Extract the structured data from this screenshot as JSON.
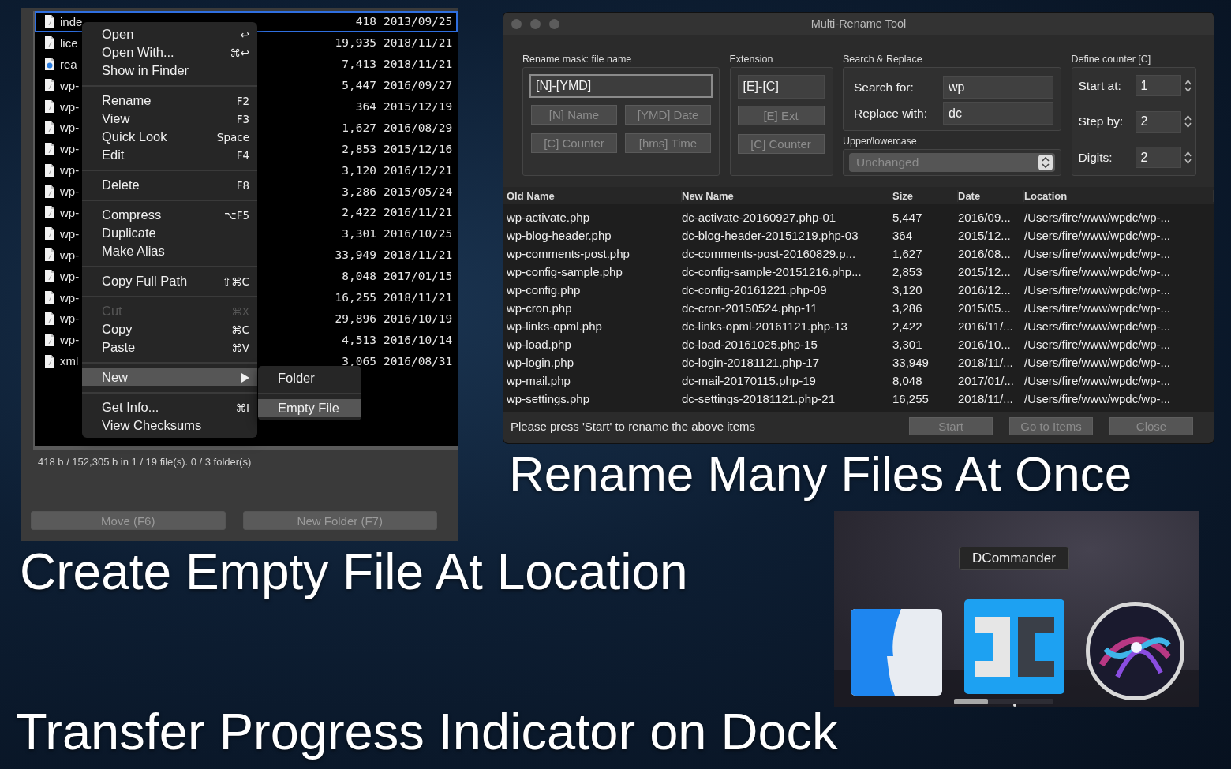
{
  "file_panel": {
    "rows": [
      {
        "name": "inde",
        "size": "418",
        "date": "2013/09/25",
        "kind": "doc",
        "selected": true
      },
      {
        "name": "lice",
        "size": "19,935",
        "date": "2018/11/21",
        "kind": "doc",
        "selected": false
      },
      {
        "name": "rea",
        "size": "7,413",
        "date": "2018/11/21",
        "kind": "web",
        "selected": false
      },
      {
        "name": "wp-",
        "size": "5,447",
        "date": "2016/09/27",
        "kind": "doc",
        "selected": false
      },
      {
        "name": "wp-",
        "size": "364",
        "date": "2015/12/19",
        "kind": "doc",
        "selected": false
      },
      {
        "name": "wp-",
        "size": "1,627",
        "date": "2016/08/29",
        "kind": "doc",
        "selected": false
      },
      {
        "name": "wp-",
        "size": "2,853",
        "date": "2015/12/16",
        "kind": "doc",
        "selected": false
      },
      {
        "name": "wp-",
        "size": "3,120",
        "date": "2016/12/21",
        "kind": "doc",
        "selected": false
      },
      {
        "name": "wp-",
        "size": "3,286",
        "date": "2015/05/24",
        "kind": "doc",
        "selected": false
      },
      {
        "name": "wp-",
        "size": "2,422",
        "date": "2016/11/21",
        "kind": "doc",
        "selected": false
      },
      {
        "name": "wp-",
        "size": "3,301",
        "date": "2016/10/25",
        "kind": "doc",
        "selected": false
      },
      {
        "name": "wp-",
        "size": "33,949",
        "date": "2018/11/21",
        "kind": "doc",
        "selected": false
      },
      {
        "name": "wp-",
        "size": "8,048",
        "date": "2017/01/15",
        "kind": "doc",
        "selected": false
      },
      {
        "name": "wp-",
        "size": "16,255",
        "date": "2018/11/21",
        "kind": "doc",
        "selected": false
      },
      {
        "name": "wp-",
        "size": "29,896",
        "date": "2016/10/19",
        "kind": "doc",
        "selected": false
      },
      {
        "name": "wp-",
        "size": "4,513",
        "date": "2016/10/14",
        "kind": "doc",
        "selected": false
      },
      {
        "name": "xml",
        "size": "3,065",
        "date": "2016/08/31",
        "kind": "doc",
        "selected": false
      }
    ],
    "status": "418 b / 152,305 b in 1 / 19 file(s).  0 / 3 folder(s)",
    "buttons": [
      {
        "label": "Move (F6)",
        "disabled": true
      },
      {
        "label": "New Folder (F7)",
        "disabled": true
      }
    ]
  },
  "context_menu": {
    "groups": [
      [
        {
          "label": "Open",
          "shortcut": "↩",
          "disabled": false,
          "selected": false
        },
        {
          "label": "Open With...",
          "shortcut": "⌘↩",
          "disabled": false,
          "selected": false
        },
        {
          "label": "Show in Finder",
          "disabled": false,
          "selected": false
        }
      ],
      [
        {
          "label": "Rename",
          "shortcut": "F2",
          "disabled": false,
          "selected": false
        },
        {
          "label": "View",
          "shortcut": "F3",
          "disabled": false,
          "selected": false
        },
        {
          "label": "Quick Look",
          "shortcut": "Space",
          "disabled": false,
          "selected": false
        },
        {
          "label": "Edit",
          "shortcut": "F4",
          "disabled": false,
          "selected": false
        }
      ],
      [
        {
          "label": "Delete",
          "shortcut": "F8",
          "disabled": false,
          "selected": false
        }
      ],
      [
        {
          "label": "Compress",
          "shortcut": "⌥F5",
          "disabled": false,
          "selected": false
        },
        {
          "label": "Duplicate",
          "disabled": false,
          "selected": false
        },
        {
          "label": "Make Alias",
          "disabled": false,
          "selected": false
        }
      ],
      [
        {
          "label": "Copy Full Path",
          "shortcut": "⇧⌘C",
          "disabled": false,
          "selected": false
        }
      ],
      [
        {
          "label": "Cut",
          "shortcut": "⌘X",
          "disabled": true,
          "selected": false
        },
        {
          "label": "Copy",
          "shortcut": "⌘C",
          "disabled": false,
          "selected": false
        },
        {
          "label": "Paste",
          "shortcut": "⌘V",
          "disabled": false,
          "selected": false
        }
      ],
      [
        {
          "label": "New",
          "submenu": true,
          "disabled": false,
          "selected": true
        }
      ],
      [
        {
          "label": "Get Info...",
          "shortcut": "⌘I",
          "disabled": false,
          "selected": false
        },
        {
          "label": "View Checksums",
          "disabled": false,
          "selected": false
        }
      ]
    ],
    "submenu": {
      "items": [
        {
          "label": "Folder",
          "selected": false
        },
        {
          "label": "Empty File",
          "selected": true
        }
      ]
    }
  },
  "rename_tool": {
    "title": "Multi-Rename Tool",
    "mask": {
      "label": "Rename mask: file name",
      "value": "[N]-[YMD]",
      "buttons": [
        {
          "label": "[N] Name",
          "disabled": true
        },
        {
          "label": "[YMD] Date",
          "disabled": true
        },
        {
          "label": "[C] Counter",
          "disabled": true
        },
        {
          "label": "[hms] Time",
          "disabled": true
        }
      ]
    },
    "extension": {
      "label": "Extension",
      "value": "[E]-[C]",
      "buttons": [
        {
          "label": "[E] Ext",
          "disabled": true
        },
        {
          "label": "[C] Counter",
          "disabled": true
        }
      ]
    },
    "search_replace": {
      "label": "Search & Replace",
      "fields": [
        {
          "label": "Search for:",
          "value": "wp"
        },
        {
          "label": "Replace with:",
          "value": "dc"
        }
      ]
    },
    "case": {
      "label": "Upper/lowercase",
      "value": "Unchanged",
      "disabled": true
    },
    "counter": {
      "label": "Define counter [C]",
      "fields": [
        {
          "label": "Start at:",
          "value": "1"
        },
        {
          "label": "Step by:",
          "value": "2"
        },
        {
          "label": "Digits:",
          "value": "2"
        }
      ]
    },
    "table": {
      "columns": [
        "Old Name",
        "New Name",
        "Size",
        "Date",
        "Location"
      ],
      "rows": [
        [
          "wp-activate.php",
          "dc-activate-20160927.php-01",
          "5,447",
          "2016/09...",
          "/Users/fire/www/wpdc/wp-..."
        ],
        [
          "wp-blog-header.php",
          "dc-blog-header-20151219.php-03",
          "364",
          "2015/12...",
          "/Users/fire/www/wpdc/wp-..."
        ],
        [
          "wp-comments-post.php",
          "dc-comments-post-20160829.p...",
          "1,627",
          "2016/08...",
          "/Users/fire/www/wpdc/wp-..."
        ],
        [
          "wp-config-sample.php",
          "dc-config-sample-20151216.php...",
          "2,853",
          "2015/12...",
          "/Users/fire/www/wpdc/wp-..."
        ],
        [
          "wp-config.php",
          "dc-config-20161221.php-09",
          "3,120",
          "2016/12...",
          "/Users/fire/www/wpdc/wp-..."
        ],
        [
          "wp-cron.php",
          "dc-cron-20150524.php-11",
          "3,286",
          "2015/05...",
          "/Users/fire/www/wpdc/wp-..."
        ],
        [
          "wp-links-opml.php",
          "dc-links-opml-20161121.php-13",
          "2,422",
          "2016/11/...",
          "/Users/fire/www/wpdc/wp-..."
        ],
        [
          "wp-load.php",
          "dc-load-20161025.php-15",
          "3,301",
          "2016/10...",
          "/Users/fire/www/wpdc/wp-..."
        ],
        [
          "wp-login.php",
          "dc-login-20181121.php-17",
          "33,949",
          "2018/11/...",
          "/Users/fire/www/wpdc/wp-..."
        ],
        [
          "wp-mail.php",
          "dc-mail-20170115.php-19",
          "8,048",
          "2017/01/...",
          "/Users/fire/www/wpdc/wp-..."
        ],
        [
          "wp-settings.php",
          "dc-settings-20181121.php-21",
          "16,255",
          "2018/11/...",
          "/Users/fire/www/wpdc/wp-..."
        ]
      ]
    },
    "status": "Please press 'Start' to rename the above items",
    "buttons": [
      {
        "label": "Start",
        "disabled": true
      },
      {
        "label": "Go to Items",
        "disabled": true
      },
      {
        "label": "Close",
        "disabled": true
      }
    ]
  },
  "headlines": [
    "Rename Many Files At Once",
    "Create Empty File At Location",
    "Transfer Progress Indicator on Dock"
  ],
  "dock": {
    "tooltip": "DCommander",
    "apps": [
      {
        "kind": "finder"
      },
      {
        "kind": "dcommander",
        "running": true,
        "progress": {
          "level": 0.34
        }
      },
      {
        "kind": "siri"
      }
    ]
  }
}
